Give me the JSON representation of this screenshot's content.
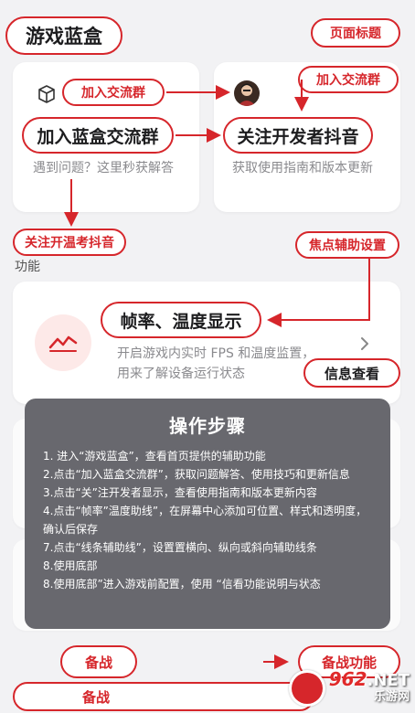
{
  "header": {
    "title": "游戏蓝盒",
    "page_title_callout": "页面标题"
  },
  "cards": {
    "left": {
      "icon": "cube-icon",
      "callout_small": "加入交流群",
      "callout_big": "加入蓝盒交流群",
      "desc": "遇到问题？这里秒获解答"
    },
    "right": {
      "icon": "avatar",
      "callout_small": "加入交流群",
      "callout_big": "关注开发者抖音",
      "desc": "获取使用指南和版本更新"
    }
  },
  "section": {
    "callout_left": "关注开温考抖音",
    "callout_right": "焦点辅助设置",
    "label": "功能"
  },
  "feature": {
    "icon": "trend-line-icon",
    "title": "帧率、温度显示",
    "desc": "开启游戏内实时 FPS 和温度监置，用来了解设备运行状态",
    "info_callout": "信息查看"
  },
  "steps": {
    "title": "操作步骤",
    "items": [
      "1. 进入“游戏蓝盒”，查看首页提供的辅助功能",
      "2.点击“加入蓝盒交流群”，获取问题解答、使用技巧和更新信息",
      "3.点击“关”注开发者显示，查看使用指南和版本更新内容",
      "4.点击“帧率”温度助线”，在屏幕中心添加可位置、样式和透明度，确认后保存",
      "7.点击“线条辅助线”，设置置横向、纵向或斜向辅助线条",
      "8.使用底部",
      "8.使用底部”进入游戏前配置，使用 “信看功能说明与状态"
    ]
  },
  "bottom": {
    "btn1": "备战",
    "btn2": "备战功能",
    "btn3": "备战"
  },
  "watermark": {
    "digits": "962",
    "suffix": ".NET",
    "sub": "乐游网"
  },
  "colors": {
    "accent": "#d6262b",
    "overlay": "#626268",
    "background": "#f2f2f4"
  }
}
